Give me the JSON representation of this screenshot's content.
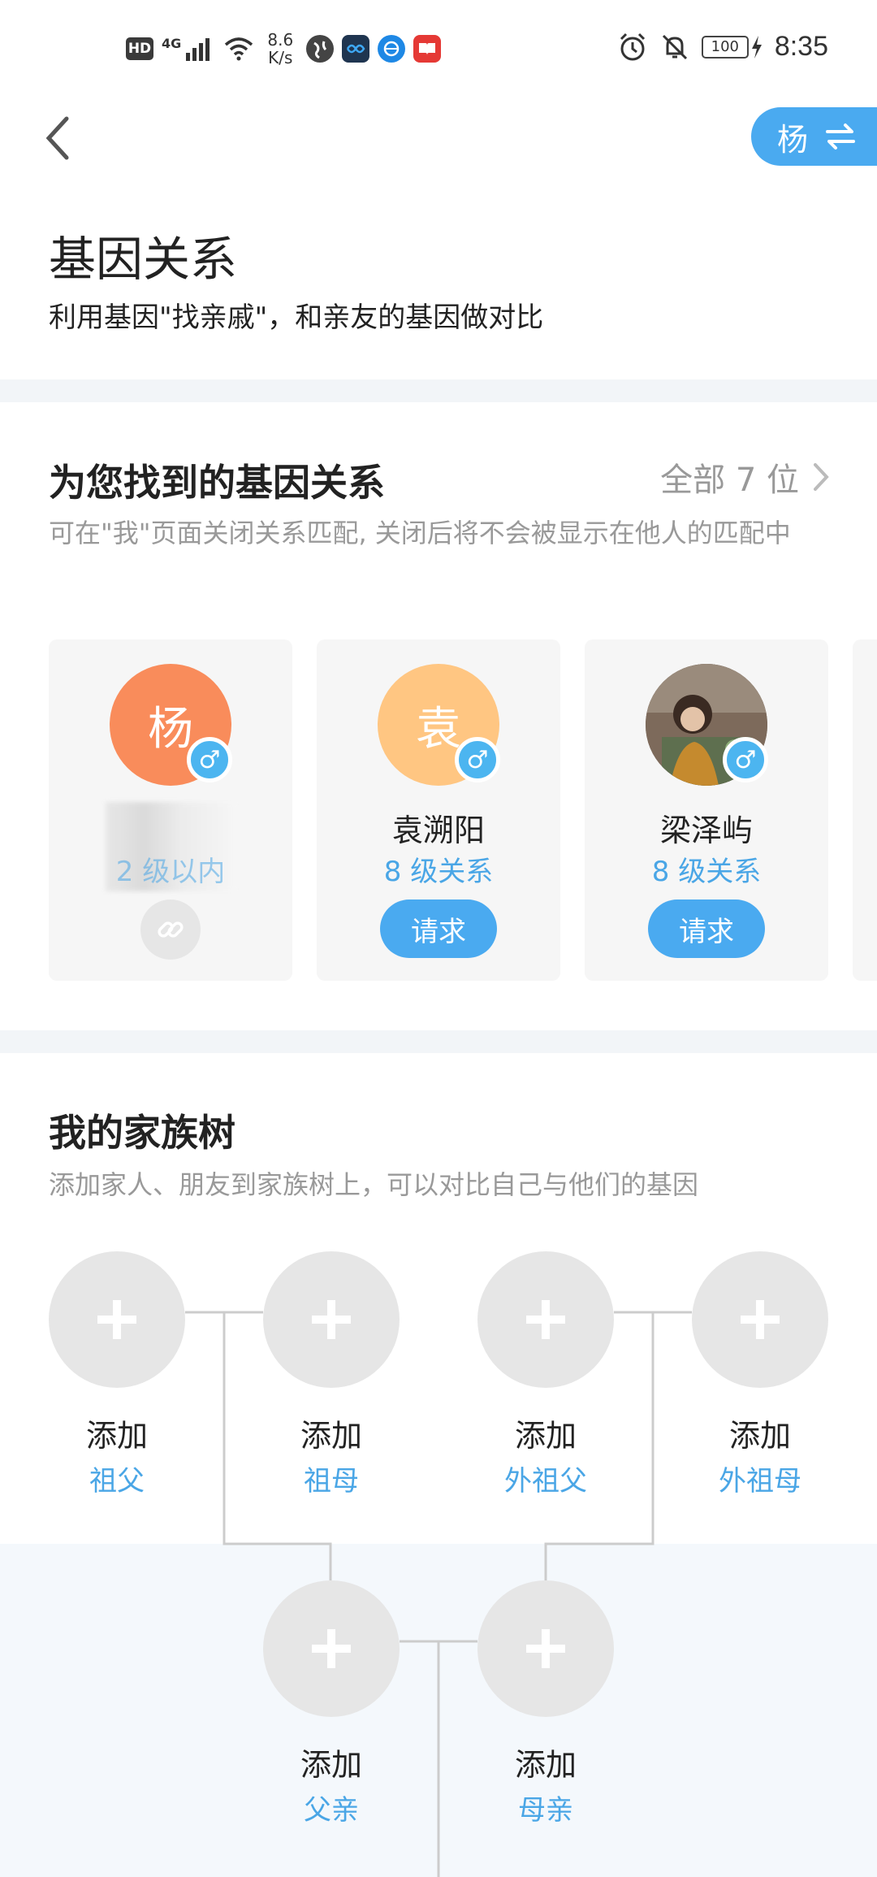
{
  "status_bar": {
    "hd": "HD",
    "network": "4G",
    "speed_value": "8.6",
    "speed_unit": "K/s",
    "battery": "100",
    "time": "8:35"
  },
  "header": {
    "user_initial": "杨",
    "title": "基因关系",
    "subtitle": "利用基因\"找亲戚\"，和亲友的基因做对比"
  },
  "matches": {
    "title": "为您找到的基因关系",
    "see_all": "全部 7 位",
    "description": "可在\"我\"页面关闭关系匹配, 关闭后将不会被显示在他人的匹配中",
    "cards": [
      {
        "initial": "杨",
        "name": "",
        "level": "2 级以内",
        "action": "link",
        "avatar_color": "#f98c5b"
      },
      {
        "initial": "袁",
        "name": "袁溯阳",
        "level": "8 级关系",
        "action_label": "请求",
        "avatar_color": "#ffc682"
      },
      {
        "initial": "",
        "name": "梁泽屿",
        "level": "8 级关系",
        "action_label": "请求",
        "avatar_color": "#6b5a4e"
      }
    ]
  },
  "family_tree": {
    "title": "我的家族树",
    "description": "添加家人、朋友到家族树上，可以对比自己与他们的基因",
    "add_label": "添加",
    "nodes": {
      "grandfather": "祖父",
      "grandmother": "祖母",
      "maternal_grandfather": "外祖父",
      "maternal_grandmother": "外祖母",
      "father": "父亲",
      "mother": "母亲"
    }
  },
  "colors": {
    "accent": "#4aaaf0",
    "link_text": "#4aa6e6",
    "muted_text": "#999999",
    "section_gap": "#f2f5f8"
  }
}
